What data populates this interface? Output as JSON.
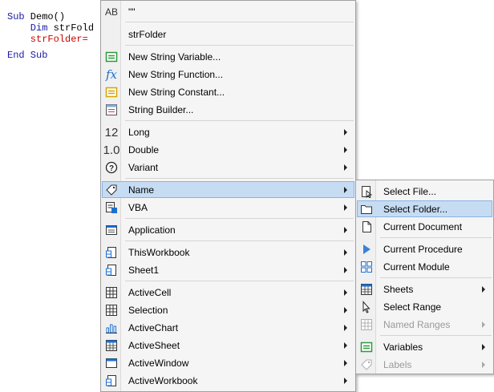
{
  "code": {
    "line1_kw": "Sub",
    "line1_id": " Demo()",
    "line2_kw": "    Dim",
    "line2_id": " strFold",
    "line3": "    strFolder=",
    "line4": "End Sub"
  },
  "menu": {
    "items": [
      {
        "label": "\"\"",
        "icon": "text-ab-icon"
      },
      {
        "label": "strFolder",
        "icon": ""
      },
      {
        "label": "New String Variable...",
        "icon": "variable-icon"
      },
      {
        "label": "New String Function...",
        "icon": "function-icon"
      },
      {
        "label": "New String Constant...",
        "icon": "constant-icon"
      },
      {
        "label": "String Builder...",
        "icon": "string-builder-icon"
      },
      {
        "label": "Long",
        "icon": "long-12-icon",
        "glyph": "12"
      },
      {
        "label": "Double",
        "icon": "double-10-icon",
        "glyph": "1.0"
      },
      {
        "label": "Variant",
        "icon": "question-icon",
        "glyph": "?"
      },
      {
        "label": "Name",
        "icon": "tag-icon"
      },
      {
        "label": "VBA",
        "icon": "vba-icon"
      },
      {
        "label": "Application",
        "icon": "application-icon"
      },
      {
        "label": "ThisWorkbook",
        "icon": "workbook-icon"
      },
      {
        "label": "Sheet1",
        "icon": "sheet-icon"
      },
      {
        "label": "ActiveCell",
        "icon": "cell-grid-icon"
      },
      {
        "label": "Selection",
        "icon": "selection-grid-icon"
      },
      {
        "label": "ActiveChart",
        "icon": "chart-icon"
      },
      {
        "label": "ActiveSheet",
        "icon": "active-sheet-icon"
      },
      {
        "label": "ActiveWindow",
        "icon": "window-icon"
      },
      {
        "label": "ActiveWorkbook",
        "icon": "active-workbook-icon"
      }
    ]
  },
  "submenu": {
    "items": [
      {
        "label": "Select File...",
        "icon": "select-file-icon"
      },
      {
        "label": "Select Folder...",
        "icon": "folder-icon"
      },
      {
        "label": "Current Document",
        "icon": "document-icon"
      },
      {
        "label": "Current Procedure",
        "icon": "play-icon"
      },
      {
        "label": "Current Module",
        "icon": "module-icon"
      },
      {
        "label": "Sheets",
        "icon": "sheets-icon"
      },
      {
        "label": "Select Range",
        "icon": "cursor-icon"
      },
      {
        "label": "Named Ranges",
        "icon": "named-ranges-icon"
      },
      {
        "label": "Variables",
        "icon": "variables-icon"
      },
      {
        "label": "Labels",
        "icon": "labels-icon"
      }
    ]
  },
  "colors": {
    "highlight": "#c6dcf3",
    "highlight_border": "#88b3e1",
    "keyword": "#1a1aa6",
    "string_red": "#cc0000",
    "icon_green": "#2e9a3c",
    "icon_yellow": "#d4a400",
    "icon_blue": "#1e6fcf"
  }
}
